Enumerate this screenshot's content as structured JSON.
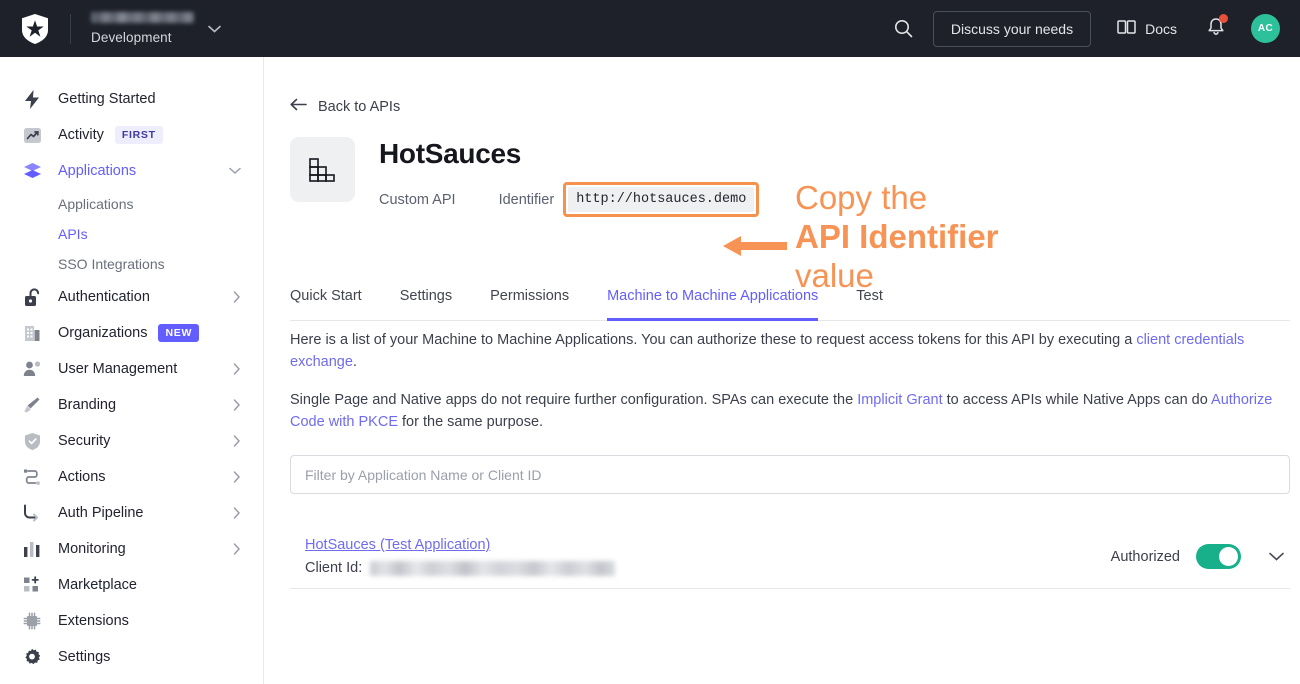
{
  "topbar": {
    "logo_icon": "auth0-logo-icon",
    "tenant_name_redacted": true,
    "environment": "Development",
    "tenant_caret_icon": "chevron-down-icon",
    "search_icon": "search-icon",
    "discuss_label": "Discuss your needs",
    "docs_icon": "book-icon",
    "docs_label": "Docs",
    "bell_icon": "bell-icon",
    "notification_dot": true,
    "avatar_initials": "AC",
    "avatar_color": "#2cc19a",
    "background": "#1e212a"
  },
  "sidebar": {
    "items": [
      {
        "label": "Getting Started",
        "icon": "lightning-icon",
        "badge": null,
        "chevron": null,
        "active": false
      },
      {
        "label": "Activity",
        "icon": "trending-up-icon",
        "badge": "FIRST",
        "badge_type": "first",
        "chevron": null,
        "active": false
      },
      {
        "label": "Applications",
        "icon": "layers-icon",
        "badge": null,
        "chevron": "chevron-down-icon",
        "active": true
      },
      {
        "label": "Authentication",
        "icon": "lock-open-icon",
        "badge": null,
        "chevron": "chevron-right-icon",
        "active": false
      },
      {
        "label": "Organizations",
        "icon": "building-icon",
        "badge": "NEW",
        "badge_type": "new",
        "chevron": null,
        "active": false
      },
      {
        "label": "User Management",
        "icon": "user-gear-icon",
        "badge": null,
        "chevron": "chevron-right-icon",
        "active": false
      },
      {
        "label": "Branding",
        "icon": "brush-icon",
        "badge": null,
        "chevron": "chevron-right-icon",
        "active": false
      },
      {
        "label": "Security",
        "icon": "shield-check-icon",
        "badge": null,
        "chevron": "chevron-right-icon",
        "active": false
      },
      {
        "label": "Actions",
        "icon": "flow-icon",
        "badge": null,
        "chevron": "chevron-right-icon",
        "active": false
      },
      {
        "label": "Auth Pipeline",
        "icon": "pipeline-icon",
        "badge": null,
        "chevron": "chevron-right-icon",
        "active": false
      },
      {
        "label": "Monitoring",
        "icon": "bar-chart-icon",
        "badge": null,
        "chevron": "chevron-right-icon",
        "active": false
      },
      {
        "label": "Marketplace",
        "icon": "grid-plus-icon",
        "badge": null,
        "chevron": null,
        "active": false
      },
      {
        "label": "Extensions",
        "icon": "chip-icon",
        "badge": null,
        "chevron": null,
        "active": false
      },
      {
        "label": "Settings",
        "icon": "gear-icon",
        "badge": null,
        "chevron": null,
        "active": false
      }
    ],
    "sub_items": [
      {
        "label": "Applications",
        "active": false
      },
      {
        "label": "APIs",
        "active": true
      },
      {
        "label": "SSO Integrations",
        "active": false
      }
    ],
    "accent_color": "#635dff"
  },
  "main": {
    "back_link": "Back to APIs",
    "back_icon": "arrow-left-icon",
    "api_tile_icon": "api-blocks-icon",
    "api_title": "HotSauces",
    "api_type": "Custom API",
    "identifier_label": "Identifier",
    "identifier_value": "http://hotsauces.demo",
    "identifier_highlight_color": "#f5924e",
    "tabs": [
      {
        "label": "Quick Start",
        "active": false
      },
      {
        "label": "Settings",
        "active": false
      },
      {
        "label": "Permissions",
        "active": false
      },
      {
        "label": "Machine to Machine Applications",
        "active": true
      },
      {
        "label": "Test",
        "active": false
      }
    ],
    "paragraph1": {
      "part1": "Here is a list of your Machine to Machine Applications. You can authorize these to request access tokens for this API by executing a ",
      "link1": "client credentials exchange",
      "part2": "."
    },
    "paragraph2": {
      "part1": "Single Page and Native apps do not require further configuration. SPAs can execute the ",
      "link1": "Implicit Grant",
      "part2": " to access APIs while Native Apps can do ",
      "link2": "Authorize Code with PKCE",
      "part3": " for the same purpose."
    },
    "filter_placeholder": "Filter by Application Name or Client ID",
    "filter_value": "",
    "application": {
      "name": "HotSauces (Test Application)",
      "client_id_label": "Client Id:",
      "client_id_redacted": true,
      "authorized_label": "Authorized",
      "authorized": true,
      "toggle_color": "#17b08a",
      "expand_icon": "chevron-down-icon"
    }
  },
  "annotation": {
    "arrow_icon": "arrow-left-annotation-icon",
    "line1": "Copy the",
    "line2": "API Identifier",
    "line3": "value",
    "color": "#f79455"
  }
}
